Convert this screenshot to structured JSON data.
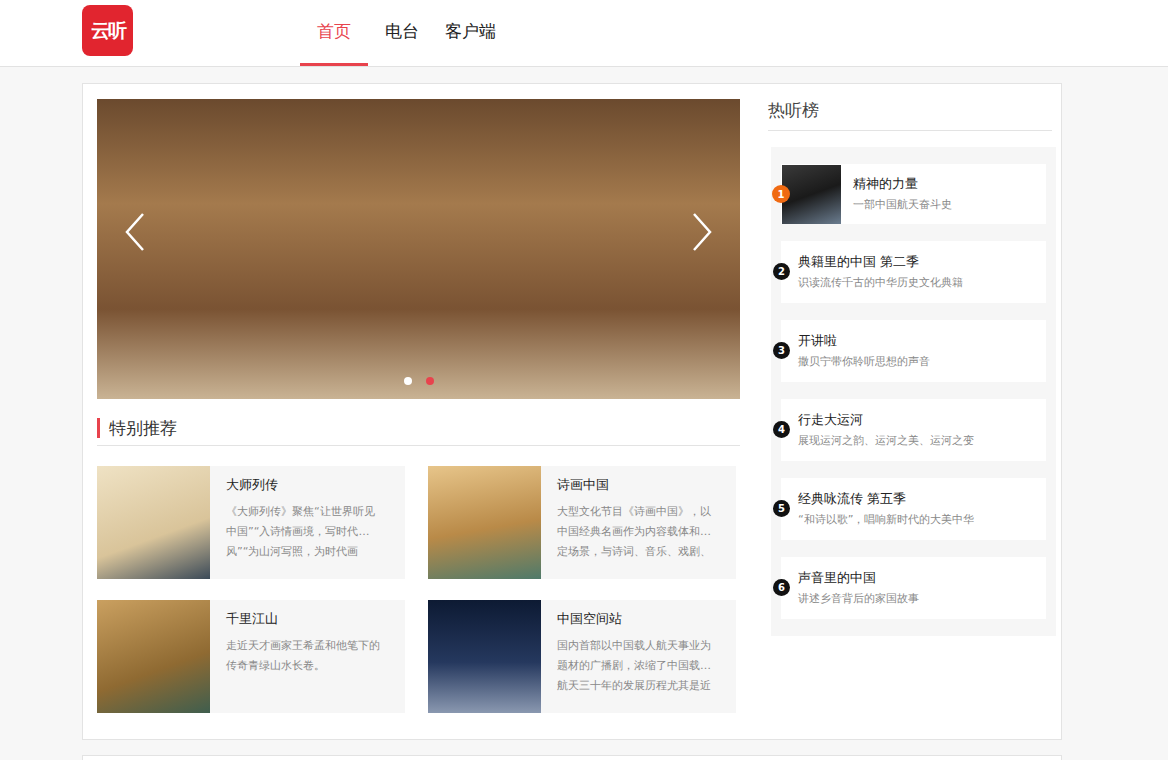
{
  "logo": {
    "text": "云听"
  },
  "nav": [
    {
      "label": "首页",
      "selected": true
    },
    {
      "label": "电台",
      "selected": false
    },
    {
      "label": "客户端",
      "selected": false
    }
  ],
  "banner": {
    "dots": [
      {
        "selected": false
      },
      {
        "selected": true
      }
    ]
  },
  "recommend": {
    "title": "特别推荐",
    "cards": [
      {
        "title": "大师列传",
        "desc": [
          "《大师列传》聚焦“让世界听见",
          "中国”“入诗情画境，写时代…",
          "风”“为山河写照，为时代画"
        ]
      },
      {
        "title": "诗画中国",
        "desc": [
          "大型文化节目《诗画中国》，以",
          "中国经典名画作为内容载体和…",
          "定场景，与诗词、音乐、戏剧、"
        ]
      },
      {
        "title": "千里江山",
        "desc": [
          "走近天才画家王希孟和他笔下的",
          "传奇青绿山水长卷。"
        ]
      },
      {
        "title": "中国空间站",
        "desc": [
          "国内首部以中国载人航天事业为",
          "题材的广播剧，浓缩了中国载…",
          "航天三十年的发展历程尤其是近"
        ]
      }
    ]
  },
  "hot": {
    "title": "热听榜",
    "items": [
      {
        "rank": "1",
        "title": "精神的力量",
        "subtitle": "一部中国航天奋斗史",
        "kind": "thumb"
      },
      {
        "rank": "2",
        "title": "典籍里的中国 第二季",
        "subtitle": "识读流传千古的中华历史文化典籍",
        "kind": "plain"
      },
      {
        "rank": "3",
        "title": "开讲啦",
        "subtitle": "撒贝宁带你聆听思想的声音",
        "kind": "plain"
      },
      {
        "rank": "4",
        "title": "行走大运河",
        "subtitle": "展现运河之韵、运河之美、运河之变",
        "kind": "plain"
      },
      {
        "rank": "5",
        "title": "经典咏流传 第五季",
        "subtitle": "“和诗以歌”，唱响新时代的大美中华",
        "kind": "plain"
      },
      {
        "rank": "6",
        "title": "声音里的中国",
        "subtitle": "讲述乡音背后的家国故事",
        "kind": "plain"
      }
    ]
  }
}
